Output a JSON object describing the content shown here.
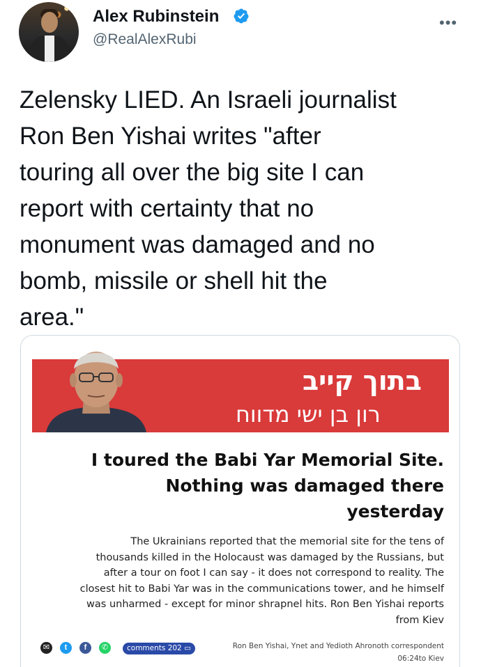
{
  "author": {
    "name": "Alex Rubinstein",
    "handle": "@RealAlexRubi"
  },
  "more_icon": "more-dots-icon",
  "tweet": {
    "lines": [
      "Zelensky LIED. An Israeli journalist",
      "Ron Ben Yishai writes \"after",
      "touring all over the big site I can",
      "report with certainty that no",
      "monument was damaged and no",
      "bomb, missile or shell hit the",
      "area.\""
    ]
  },
  "card": {
    "banner": {
      "line1": "בתוך קייב",
      "line2": "רון בן ישי מדווח"
    },
    "headline": [
      "I toured the Babi Yar Memorial Site.",
      "Nothing was damaged there",
      "yesterday"
    ],
    "body": [
      "The Ukrainians reported that the memorial site for the tens of",
      "thousands killed in the Holocaust was damaged by the Russians, but",
      "after a tour on foot I can say - it does not correspond to reality. The",
      "closest hit to Babi Yar was in the communications tower, and he himself",
      "was unharmed - except for minor shrapnel hits. Ron Ben Yishai reports",
      "from Kiev"
    ],
    "comments_label": "comments 202",
    "byline": "Ron Ben Yishai, Ynet and Yedioth Ahronoth correspondent",
    "dateline": "06:24to  Kiev"
  },
  "colors": {
    "banner_red": "#d93a3a",
    "verified_blue": "#1d9bf0",
    "pill_blue": "#2a4aa8"
  }
}
